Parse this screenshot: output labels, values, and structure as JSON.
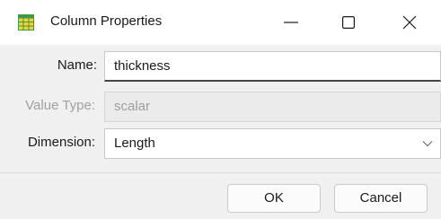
{
  "window": {
    "title": "Column Properties"
  },
  "form": {
    "name": {
      "label": "Name:",
      "value": "thickness"
    },
    "value_type": {
      "label": "Value Type:",
      "value": "scalar"
    },
    "dimension": {
      "label": "Dimension:",
      "value": "Length"
    }
  },
  "buttons": {
    "ok": "OK",
    "cancel": "Cancel"
  },
  "icons": {
    "app": "table-grid-icon",
    "minimize": "minimize-icon",
    "maximize": "maximize-icon",
    "close": "close-icon",
    "dropdown": "chevron-down-icon"
  },
  "colors": {
    "app_icon_green": "#3e9a3e",
    "app_icon_yellow": "#f1d23a"
  }
}
